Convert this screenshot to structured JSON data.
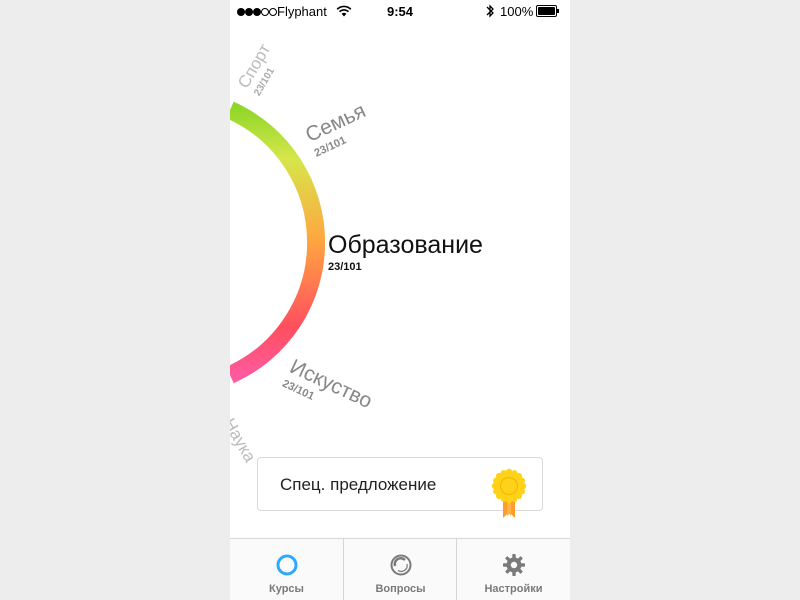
{
  "status_bar": {
    "carrier": "Flyphant",
    "time": "9:54",
    "battery_percent": "100%",
    "signal_bars": 3,
    "signal_total": 5
  },
  "wheel": {
    "categories": [
      {
        "name": "Спорт",
        "count": "23/101"
      },
      {
        "name": "Семья",
        "count": "23/101"
      },
      {
        "name": "Образование",
        "count": "23/101",
        "selected": true
      },
      {
        "name": "Искуство",
        "count": "23/101"
      },
      {
        "name": "Наука",
        "count": ""
      }
    ],
    "gradient_colors": [
      "#7ed321",
      "#d6e64a",
      "#ffa640",
      "#ff4f5e",
      "#ff5cab"
    ]
  },
  "special_offer": {
    "label": "Спец. предложение",
    "icon": "ribbon-badge-icon"
  },
  "tabs": [
    {
      "label": "Курсы",
      "icon": "courses-circle-icon",
      "active": true
    },
    {
      "label": "Вопросы",
      "icon": "questions-circle-icon",
      "active": false
    },
    {
      "label": "Настройки",
      "icon": "gear-icon",
      "active": false
    }
  ],
  "colors": {
    "accent": "#2fa8ff",
    "tab_inactive": "#7a7a7a",
    "badge_gold": "#ffd21a",
    "ribbon_orange": "#ff9c2a"
  }
}
